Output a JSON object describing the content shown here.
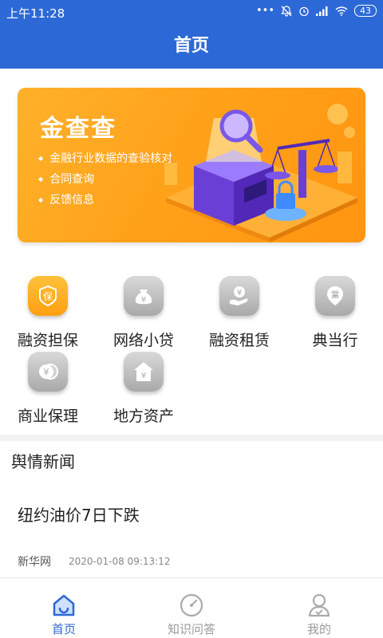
{
  "status_bar": {
    "time": "上午11:28",
    "battery": "43"
  },
  "header": {
    "title": "首页"
  },
  "banner": {
    "title": "金查查",
    "items": [
      "金融行业数据的查验核对",
      "合同查询",
      "反馈信息"
    ]
  },
  "grid": {
    "items": [
      {
        "label": "融资担保",
        "icon": "shield-bao-icon",
        "glyph": "保",
        "active": true
      },
      {
        "label": "网络小贷",
        "icon": "money-bag-icon",
        "glyph": "¥"
      },
      {
        "label": "融资租赁",
        "icon": "hand-coin-icon",
        "glyph": "¥"
      },
      {
        "label": "典当行",
        "icon": "pawn-shop-icon",
        "glyph": "當"
      },
      {
        "label": "商业保理",
        "icon": "coins-icon",
        "glyph": "¥"
      },
      {
        "label": "地方资产",
        "icon": "house-money-icon",
        "glyph": "¥"
      }
    ]
  },
  "news": {
    "section_title": "舆情新闻",
    "items": [
      {
        "headline": "纽约油价7日下跌",
        "source": "新华网",
        "time": "2020-01-08 09:13:12"
      }
    ]
  },
  "tabbar": {
    "tabs": [
      {
        "label": "首页",
        "icon": "home-icon",
        "active": true
      },
      {
        "label": "知识问答",
        "icon": "compass-icon"
      },
      {
        "label": "我的",
        "icon": "user-icon"
      }
    ]
  },
  "colors": {
    "primary": "#2d69d6",
    "banner": "#ffa21a",
    "accent": "#ff9f12"
  }
}
